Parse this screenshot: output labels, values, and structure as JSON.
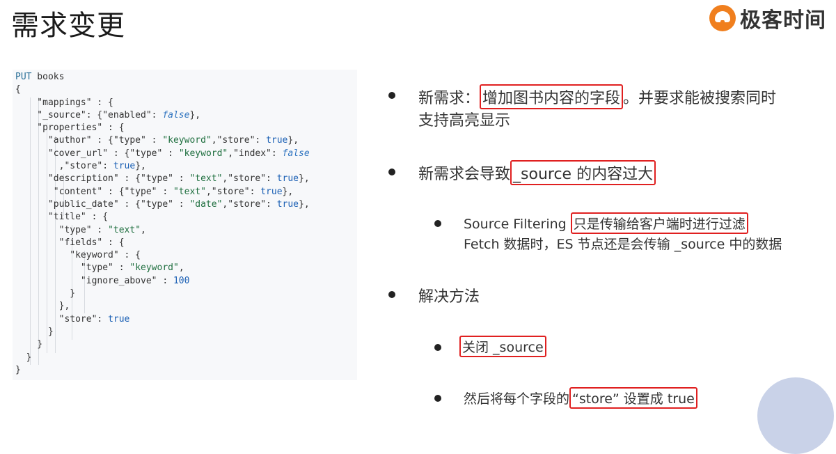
{
  "slide": {
    "title": "需求变更",
    "logo_text": "极客时间"
  },
  "code": {
    "lines": [
      "PUT books",
      "{",
      "    \"mappings\" : {",
      "    \"_source\": {\"enabled\": false},",
      "    \"properties\" : {",
      "      \"author\" : {\"type\" : \"keyword\",\"store\": true},",
      "      \"cover_url\" : {\"type\" : \"keyword\",\"index\": false",
      "        ,\"store\": true},",
      "      \"description\" : {\"type\" : \"text\",\"store\": true},",
      "       \"content\" : {\"type\" : \"text\",\"store\": true},",
      "      \"public_date\" : {\"type\" : \"date\",\"store\": true},",
      "      \"title\" : {",
      "        \"type\" : \"text\",",
      "        \"fields\" : {",
      "          \"keyword\" : {",
      "            \"type\" : \"keyword\",",
      "            \"ignore_above\" : 100",
      "          }",
      "        },",
      "        \"store\": true",
      "      }",
      "    }",
      "  }",
      "}"
    ]
  },
  "bullets": {
    "b1_prefix": "新需求：",
    "b1_highlight": "增加图书内容的字段",
    "b1_suffix": "。并要求能被搜索同时",
    "b1_line2": "支持高亮显示",
    "b2_prefix": "新需求会导致",
    "b2_highlight": "_source 的内容过大",
    "b3_prefix": "Source Filtering ",
    "b3_highlight": "只是传输给客户端时进行过滤",
    "b3_line2": "Fetch 数据时，ES 节点还是会传输 _source 中的数据",
    "b4": "解决方法",
    "b5_highlight": "关闭 _source",
    "b6_prefix": "然后将每个字段的",
    "b6_highlight": "“store” 设置成 true"
  }
}
